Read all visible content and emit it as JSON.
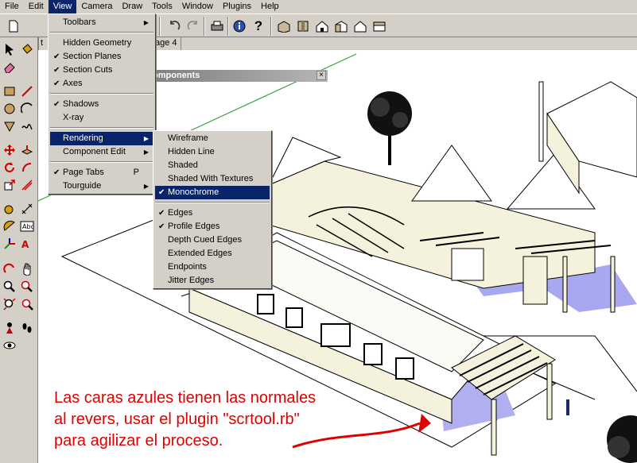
{
  "menubar": {
    "items": [
      "File",
      "Edit",
      "View",
      "Camera",
      "Draw",
      "Tools",
      "Window",
      "Plugins",
      "Help"
    ],
    "active": "View"
  },
  "scene_tabs": {
    "left_fragment": "t",
    "current": "age 4"
  },
  "components_panel": {
    "title": "omponents",
    "close": "×"
  },
  "view_menu": {
    "toolbars": "Toolbars",
    "hidden_geometry": "Hidden Geometry",
    "section_planes": "Section Planes",
    "section_cuts": "Section Cuts",
    "axes": "Axes",
    "shadows": "Shadows",
    "xray": "X-ray",
    "rendering": "Rendering",
    "component_edit": "Component Edit",
    "page_tabs": "Page Tabs",
    "page_tabs_accel": "P",
    "tourguide": "Tourguide"
  },
  "rendering_menu": {
    "wireframe": "Wireframe",
    "hidden_line": "Hidden Line",
    "shaded": "Shaded",
    "shaded_textures": "Shaded With Textures",
    "monochrome": "Monochrome",
    "edges": "Edges",
    "profile_edges": "Profile Edges",
    "depth_cued_edges": "Depth Cued Edges",
    "extended_edges": "Extended Edges",
    "endpoints": "Endpoints",
    "jitter_edges": "Jitter Edges"
  },
  "glyphs": {
    "check": "✔",
    "arrow": "▶"
  },
  "annotation": {
    "line1": "Las caras azules tienen las normales",
    "line2": "al revers, usar el plugin \"scrtool.rb\"",
    "line3": "para agilizar el proceso."
  },
  "colors": {
    "highlight": "#0a246a",
    "annotation": "#e00000",
    "reversed_faces": "#a8a8f0"
  }
}
